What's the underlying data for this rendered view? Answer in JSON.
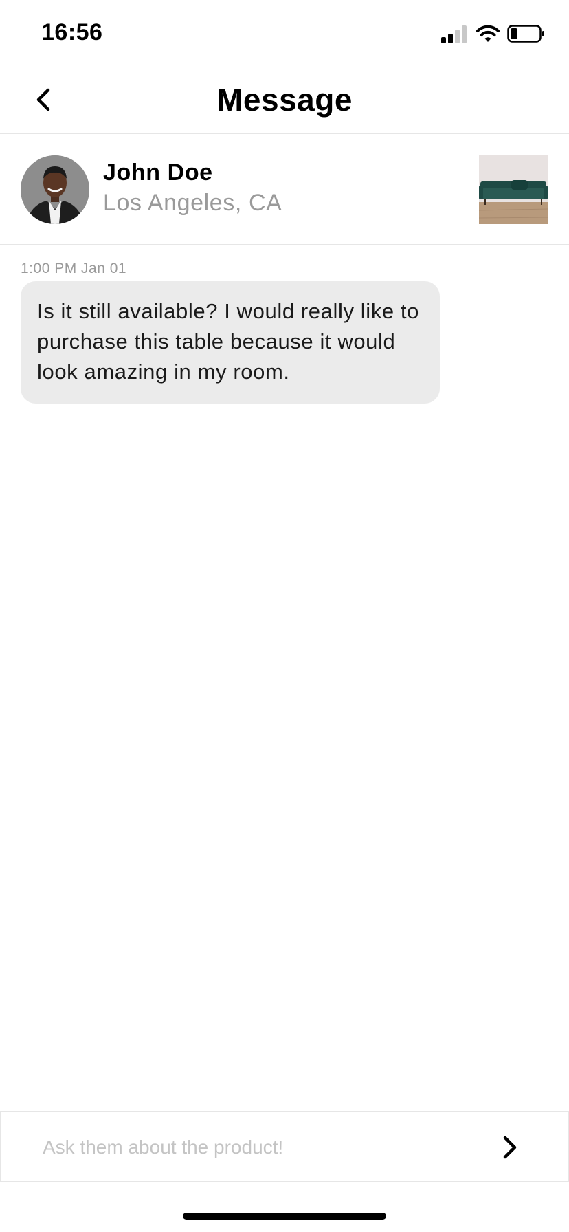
{
  "status_bar": {
    "time": "16:56"
  },
  "nav": {
    "title": "Message",
    "back_icon": "chevron-left-icon"
  },
  "seller": {
    "name": "John Doe",
    "location": "Los Angeles, CA"
  },
  "messages": [
    {
      "timestamp": "1:00 PM Jan 01",
      "text": "Is it still available? I would really like to purchase this table because it would look amazing in my room."
    }
  ],
  "composer": {
    "placeholder": "Ask them about the product!",
    "send_icon": "chevron-right-icon"
  },
  "colors": {
    "bubble": "#ebebeb",
    "divider": "#e6e6e6",
    "secondary_text": "#9a9a9a",
    "placeholder": "#c4c4c4",
    "sofa": "#1f4a45"
  }
}
